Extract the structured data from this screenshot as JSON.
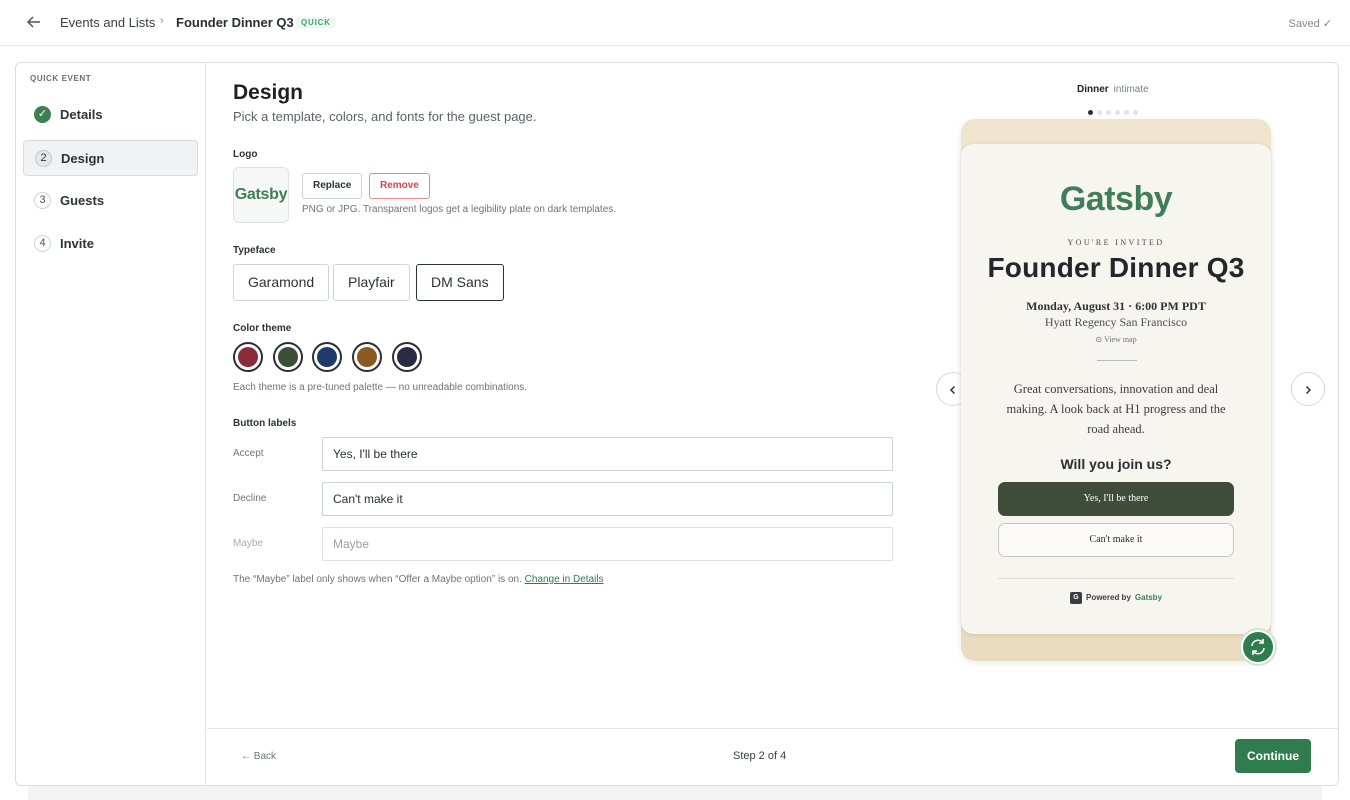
{
  "topbar": {
    "back_icon": "arrow-left-icon",
    "breadcrumb_parent": "Events and Lists",
    "breadcrumb_separator": "›",
    "breadcrumb_current": "Founder Dinner Q3",
    "badge": "QUICK",
    "saved": "Saved ✓"
  },
  "sidebar": {
    "label": "QUICK EVENT",
    "steps": [
      {
        "num": "✓",
        "label": "Details",
        "state": "done"
      },
      {
        "num": "2",
        "label": "Design",
        "state": "active"
      },
      {
        "num": "3",
        "label": "Guests",
        "state": "pending"
      },
      {
        "num": "4",
        "label": "Invite",
        "state": "pending"
      }
    ]
  },
  "design": {
    "title": "Design",
    "subtitle": "Pick a template, colors, and fonts for the guest page.",
    "logo": {
      "label": "Logo",
      "preview_text": "Gatsby",
      "replace": "Replace",
      "remove": "Remove",
      "hint": "PNG or JPG. Transparent logos get a legibility plate on dark templates."
    },
    "typeface": {
      "label": "Typeface",
      "options": [
        "Garamond",
        "Playfair",
        "DM Sans"
      ],
      "selected": "DM Sans"
    },
    "color_theme": {
      "label": "Color theme",
      "swatches": [
        "#8a2c3a",
        "#3a4f33",
        "#1f3a6b",
        "#8a5a22",
        "#2a2a45"
      ],
      "hint": "Each theme is a pre-tuned palette — no unreadable combinations."
    },
    "button_labels": {
      "label": "Button labels",
      "accept_label": "Accept",
      "accept_value": "Yes, I'll be there",
      "decline_label": "Decline",
      "decline_value": "Can't make it",
      "maybe_label": "Maybe",
      "maybe_placeholder": "Maybe",
      "note": "The “Maybe” label only shows when “Offer a Maybe option” is on.",
      "note_link": "Change in Details"
    }
  },
  "preview": {
    "tab_active": "Dinner",
    "tab_sub": "intimate",
    "brand": "Gatsby",
    "invited": "YOU'RE INVITED",
    "event_title": "Founder Dinner Q3",
    "when": "Monday, August 31 · 6:00 PM PDT",
    "where": "Hyatt Regency San Francisco",
    "map": "View map",
    "description": "Great conversations, innovation and deal making. A look back at H1 progress and the road ahead.",
    "question": "Will you join us?",
    "accept": "Yes, I'll be there",
    "decline": "Can't make it",
    "powered_by": "Powered by",
    "powered_brand": "Gatsby",
    "prev_icon": "chevron-left-icon",
    "next_icon": "chevron-right-icon",
    "refresh_icon": "refresh-icon"
  },
  "footer": {
    "back": "← Back",
    "step": "Step 2 of 4",
    "continue": "Continue"
  }
}
